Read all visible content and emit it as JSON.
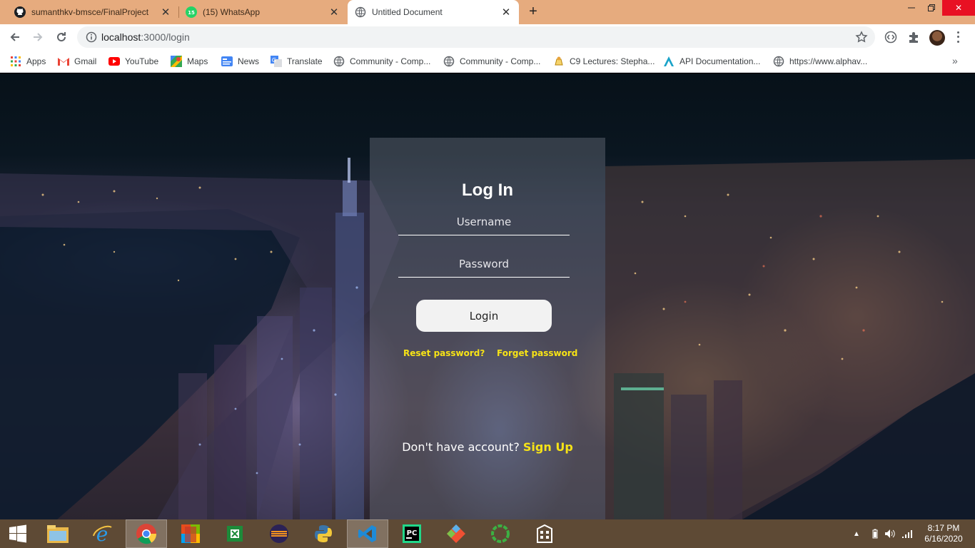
{
  "browser": {
    "tabs": [
      {
        "title": "sumanthkv-bmsce/FinalProject",
        "icon": "github-icon",
        "active": false
      },
      {
        "title": "(15) WhatsApp",
        "icon": "whatsapp-icon",
        "badge": "15",
        "active": false
      },
      {
        "title": "Untitled Document",
        "icon": "globe-icon",
        "active": true
      }
    ],
    "url_host": "localhost",
    "url_path": ":3000/login",
    "bookmarks": [
      {
        "label": "Apps",
        "icon": "apps-grid-icon"
      },
      {
        "label": "Gmail",
        "icon": "gmail-icon"
      },
      {
        "label": "YouTube",
        "icon": "youtube-icon"
      },
      {
        "label": "Maps",
        "icon": "maps-icon"
      },
      {
        "label": "News",
        "icon": "news-icon"
      },
      {
        "label": "Translate",
        "icon": "translate-icon"
      },
      {
        "label": "Community - Comp...",
        "icon": "globe-icon"
      },
      {
        "label": "Community - Comp...",
        "icon": "globe-icon"
      },
      {
        "label": "C9 Lectures: Stepha...",
        "icon": "c9-icon"
      },
      {
        "label": "API Documentation...",
        "icon": "api-icon"
      },
      {
        "label": "https://www.alphav...",
        "icon": "globe-icon"
      }
    ],
    "bookmarks_more": "»"
  },
  "login": {
    "title": "Log In",
    "username_placeholder": "Username",
    "password_placeholder": "Password",
    "button_label": "Login",
    "reset_link": "Reset password?",
    "forget_link": "Forget password",
    "signup_prompt": "Don't have account?",
    "signup_link": "Sign Up"
  },
  "taskbar": {
    "time": "8:17 PM",
    "date": "6/16/2020",
    "apps": [
      "windows-start-icon",
      "file-explorer-icon",
      "internet-explorer-icon",
      "chrome-icon",
      "office-icon",
      "excel-icon",
      "eclipse-icon",
      "python-icon",
      "vscode-icon",
      "pycharm-icon",
      "git-icon",
      "green-ring-app-icon",
      "building-app-icon"
    ]
  },
  "colors": {
    "tabstrip": "#e6ab7e",
    "link_yellow": "#f7e316",
    "taskbar": "#5e4a35"
  }
}
